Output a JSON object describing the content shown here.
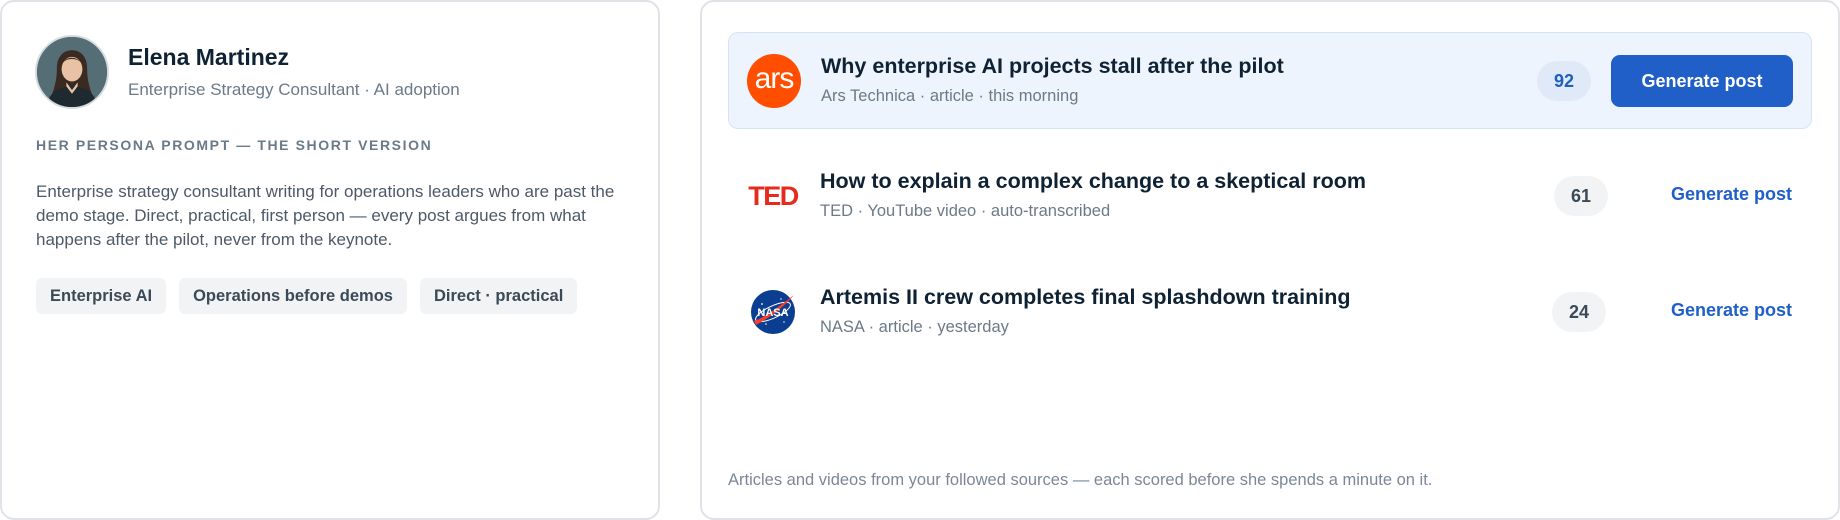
{
  "persona": {
    "name": "Elena Martinez",
    "role": "Enterprise Strategy Consultant · AI adoption",
    "prompt_heading": "HER PERSONA PROMPT — THE SHORT VERSION",
    "prompt_text": "Enterprise strategy consultant writing for operations leaders who are past the demo stage. Direct, practical, first person — every post argues from what happens after the pilot, never from the keynote.",
    "tags": [
      "Enterprise AI",
      "Operations before demos",
      "Direct · practical"
    ]
  },
  "feed": {
    "items": [
      {
        "source_logo": "ars",
        "title": "Why enterprise AI projects stall after the pilot",
        "meta": "Ars Technica · article · this morning",
        "score": "92",
        "action_label": "Generate post",
        "featured": true
      },
      {
        "source_logo": "TED",
        "title": "How to explain a complex change to a skeptical room",
        "meta": "TED · YouTube video · auto-transcribed",
        "score": "61",
        "action_label": "Generate post",
        "featured": false
      },
      {
        "source_logo": "NASA",
        "title": "Artemis II crew completes final splashdown training",
        "meta": "NASA · article · yesterday",
        "score": "24",
        "action_label": "Generate post",
        "featured": false
      }
    ],
    "footer": "Articles and videos from your followed sources — each scored before she spends a minute on it."
  },
  "colors": {
    "accent": "#1f5fc7",
    "featured_row_bg": "#eef4fd",
    "ars_orange": "#ff4e00",
    "ted_red": "#e62b1e",
    "nasa_blue": "#0b3d91"
  },
  "icons": {
    "avatar": "portrait-avatar",
    "ars": "ars-technica-logo",
    "ted": "ted-logo",
    "nasa": "nasa-meatball-logo"
  }
}
